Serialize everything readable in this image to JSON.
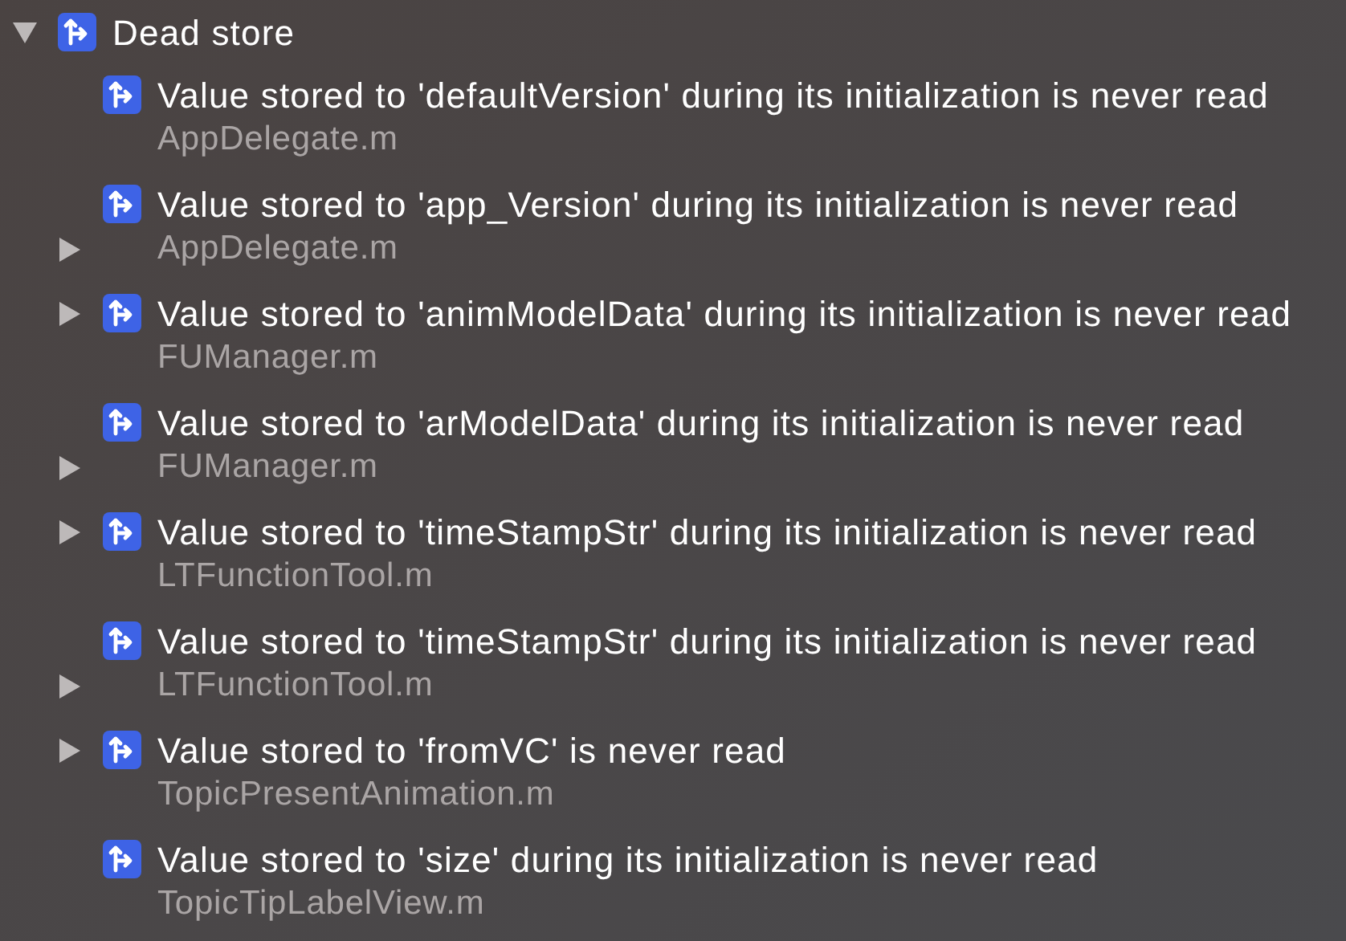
{
  "group": {
    "title": "Dead store",
    "expanded": true,
    "items": [
      {
        "message": "Value stored to 'defaultVersion' during its initialization is never read",
        "file": "AppDelegate.m",
        "kind": "plain"
      },
      {
        "message": "Value stored to 'app_Version' during its initialization is never read",
        "file": "AppDelegate.m",
        "kind": "lower"
      },
      {
        "message": "Value stored to 'animModelData' during its initialization is never read",
        "file": "FUManager.m",
        "kind": "upper"
      },
      {
        "message": "Value stored to 'arModelData' during its initialization is never read",
        "file": "FUManager.m",
        "kind": "lower"
      },
      {
        "message": "Value stored to 'timeStampStr' during its initialization is never read",
        "file": "LTFunctionTool.m",
        "kind": "upper"
      },
      {
        "message": "Value stored to 'timeStampStr' during its initialization is never read",
        "file": "LTFunctionTool.m",
        "kind": "lower"
      },
      {
        "message": "Value stored to 'fromVC' is never read",
        "file": "TopicPresentAnimation.m",
        "kind": "upper"
      },
      {
        "message": "Value stored to 'size' during its initialization is never read",
        "file": "TopicTipLabelView.m",
        "kind": "plain"
      }
    ]
  }
}
